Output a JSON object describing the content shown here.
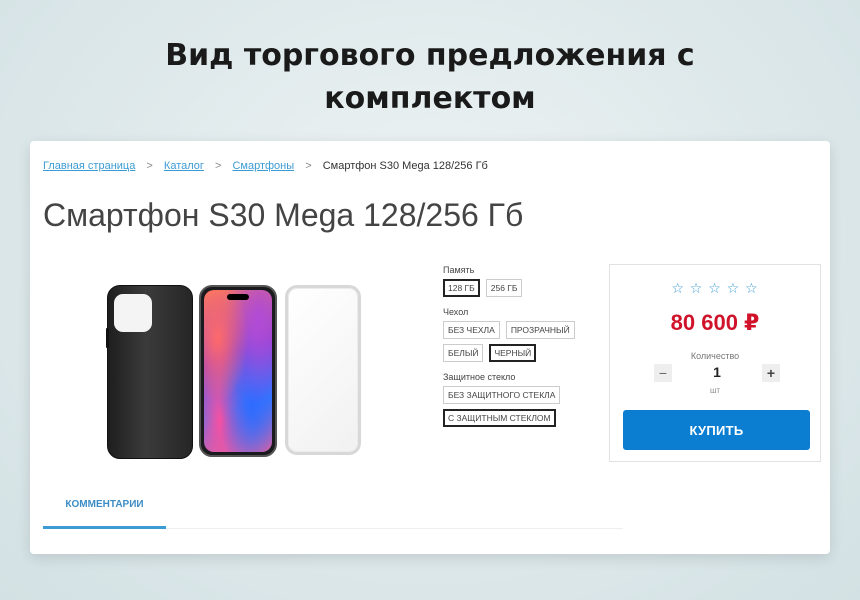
{
  "headline": {
    "line1": "Вид торгового предложения с",
    "line2": "комплектом"
  },
  "breadcrumb": {
    "items": [
      "Главная страница",
      "Каталог",
      "Смартфоны"
    ],
    "current": "Смартфон S30 Mega 128/256 Гб",
    "separator": ">"
  },
  "product": {
    "title": "Смартфон S30 Mega 128/256 Гб"
  },
  "gallery": {
    "images": [
      "black-case",
      "smartphone",
      "protective-glass"
    ]
  },
  "options": {
    "memory": {
      "label": "Память",
      "values": [
        "128 ГБ",
        "256 ГБ"
      ],
      "selected": "128 ГБ"
    },
    "case": {
      "label": "Чехол",
      "values": [
        "БЕЗ ЧЕХЛА",
        "ПРОЗРАЧНЫЙ",
        "БЕЛЫЙ",
        "ЧЕРНЫЙ"
      ],
      "selected": "ЧЕРНЫЙ"
    },
    "glass": {
      "label": "Защитное стекло",
      "values": [
        "БЕЗ ЗАЩИТНОГО СТЕКЛА",
        "С ЗАЩИТНЫМ СТЕКЛОМ"
      ],
      "selected": "С ЗАЩИТНЫМ СТЕКЛОМ"
    }
  },
  "buy_box": {
    "rating_stars": 5,
    "rating_value": 0,
    "star_glyph": "☆",
    "price": "80 600 ₽",
    "quantity_label": "Количество",
    "quantity_minus": "−",
    "quantity_plus": "+",
    "quantity": "1",
    "unit": "шт",
    "buy_label": "КУПИТЬ"
  },
  "tabs": [
    {
      "label": "КОММЕНТАРИИ",
      "active": true
    }
  ],
  "colors": {
    "accent": "#3d9bd3",
    "button": "#0c7ed2",
    "price": "#d0132a"
  }
}
